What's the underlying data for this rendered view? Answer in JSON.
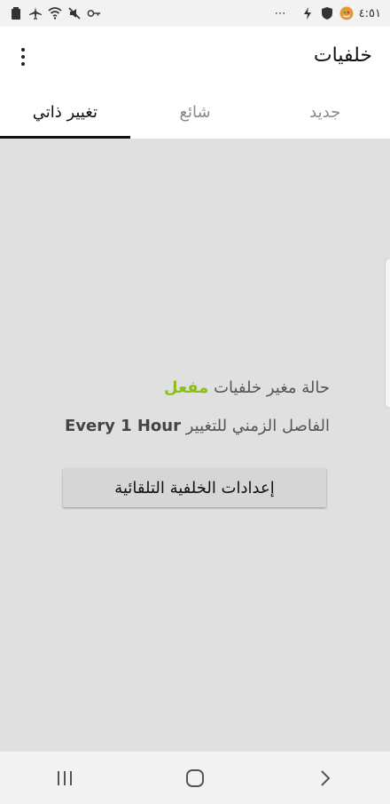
{
  "status_bar": {
    "time": "٤:٥١",
    "more_indicator": "⋯",
    "icons_left": [
      "battery-icon",
      "airplane-mode-icon",
      "wifi-icon",
      "mute-icon",
      "key-icon"
    ],
    "icons_right": [
      "charging-icon",
      "shield-icon",
      "app-notification-icon"
    ]
  },
  "appbar": {
    "title": "خلفيات"
  },
  "tabs": [
    {
      "label": "جديد",
      "active": false
    },
    {
      "label": "شائع",
      "active": false
    },
    {
      "label": "تغيير ذاتي",
      "active": true
    }
  ],
  "main": {
    "status_label": "حالة مغير خلفيات",
    "status_value": "مفعل",
    "status_value_color": "#8bc01a",
    "interval_label": "الفاصل الزمني للتغيير",
    "interval_value": "Every 1 Hour",
    "settings_button": "إعدادات الخلفية التلقائية"
  },
  "navbar": {
    "buttons": [
      "recents-icon",
      "home-icon",
      "back-icon"
    ]
  }
}
